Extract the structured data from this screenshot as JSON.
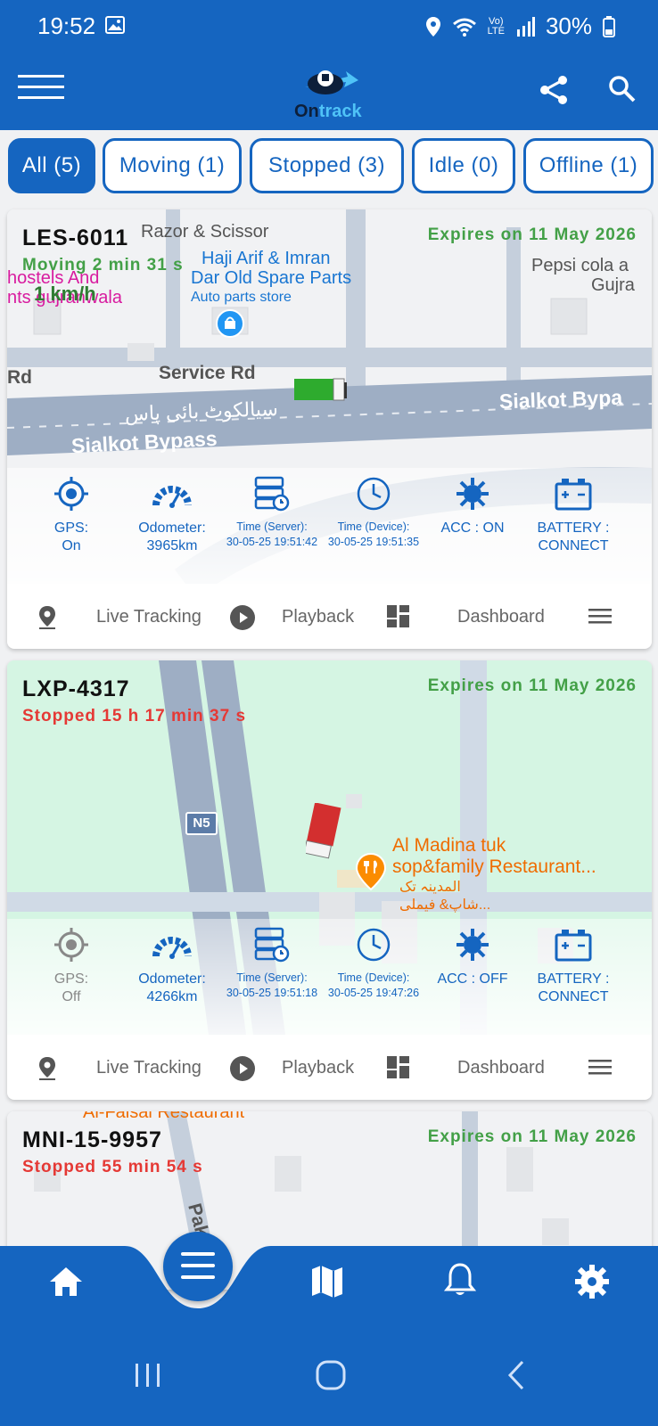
{
  "status_bar": {
    "time": "19:52",
    "battery": "30%"
  },
  "header": {
    "logo_text_dark": "On",
    "logo_text_light": "track"
  },
  "filters": [
    {
      "label": "All (5)",
      "active": true
    },
    {
      "label": "Moving (1)",
      "active": false
    },
    {
      "label": "Stopped (3)",
      "active": false
    },
    {
      "label": "Idle (0)",
      "active": false
    },
    {
      "label": "Offline (1)",
      "active": false
    }
  ],
  "vehicles": [
    {
      "plate": "LES-6011",
      "status": "Moving 2 min 31 s",
      "status_color": "#43a047",
      "speed": "1 km/h",
      "expires": "Expires on 11 May 2026",
      "map_labels": {
        "l1": "Razor & Scissor",
        "l2": "Haji Arif & Imran",
        "l3": "Dar Old Spare Parts",
        "l4": "Auto parts store",
        "l5": "Pepsi cola a",
        "l6": "Gujra",
        "l7": "hostels And",
        "l8": "nts gujranwala",
        "l9": "Service Rd",
        "l10": "Rd",
        "l11": "Sialkot Bypa",
        "l12": "سیالکوٹ بائی پاس",
        "l13": "Sialkot Bypass"
      },
      "gps_label": "GPS:",
      "gps_value": "On",
      "odometer_label": "Odometer:",
      "odometer_value": "3965km",
      "server_time_label": "Time (Server):",
      "server_time_value": "30-05-25 19:51:42",
      "device_time_label": "Time (Device):",
      "device_time_value": "30-05-25 19:51:35",
      "acc": "ACC : ON",
      "battery_label": "BATTERY :",
      "battery_value": "CONNECT"
    },
    {
      "plate": "LXP-4317",
      "status": "Stopped 15 h 17 min 37 s",
      "status_color": "#e53935",
      "expires": "Expires on 11 May 2026",
      "map_labels": {
        "l1": "N5",
        "l2": "Al Madina tuk",
        "l3": "sop&family Restaurant...",
        "l4": "المدینہ تک",
        "l5": "شاپ& فیملی..."
      },
      "gps_label": "GPS:",
      "gps_value": "Off",
      "odometer_label": "Odometer:",
      "odometer_value": "4266km",
      "server_time_label": "Time (Server):",
      "server_time_value": "30-05-25 19:51:18",
      "device_time_label": "Time (Device):",
      "device_time_value": "30-05-25 19:47:26",
      "acc": "ACC : OFF",
      "battery_label": "BATTERY :",
      "battery_value": "CONNECT"
    },
    {
      "plate": "MNI-15-9957",
      "status": "Stopped 55 min 54 s",
      "status_color": "#e53935",
      "expires": "Expires on 11 May 2026",
      "map_labels": {
        "l1": "Al-Faisal Restaurant",
        "l2": "Pak"
      }
    }
  ],
  "actions": {
    "live": "Live Tracking",
    "playback": "Playback",
    "dashboard": "Dashboard"
  },
  "colors": {
    "primary": "#1565c0",
    "moving": "#43a047",
    "stopped": "#e53935"
  }
}
